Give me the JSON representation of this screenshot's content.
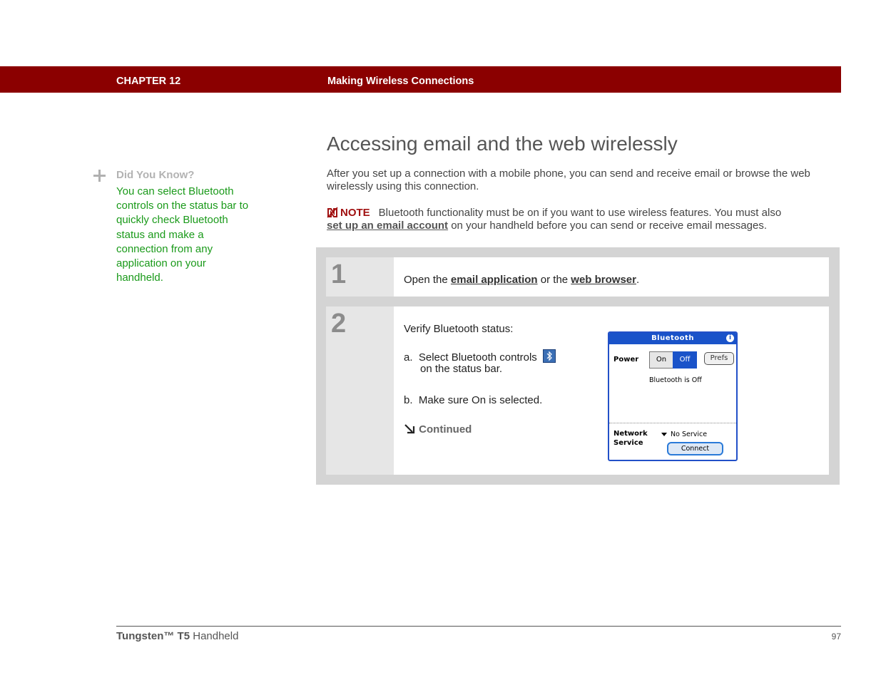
{
  "header": {
    "chapter_label": "CHAPTER 12",
    "chapter_title": "Making Wireless Connections",
    "bar_color": "#8b0000"
  },
  "sidebar": {
    "icon": "plus-icon",
    "heading": "Did You Know?",
    "text": "You can select Bluetooth controls on the status bar to quickly check Bluetooth status and make a connection from any application on your handheld.",
    "text_color": "#1a9a1a"
  },
  "main": {
    "title": "Accessing email and the web wirelessly",
    "intro": "After you set up a connection with a mobile phone, you can send and receive email or browse the web wirelessly using this connection.",
    "note": {
      "icon": "note-icon",
      "label": "NOTE",
      "text_before": "Bluetooth functionality must be on if you want to use wireless features. You must also",
      "link": "set up an email account",
      "text_after": "on your handheld before you can send or receive email messages."
    }
  },
  "steps": [
    {
      "number": "1",
      "text_before": "Open the",
      "link1": "email application",
      "text_middle": "or the",
      "link2": "web browser",
      "text_after": "."
    },
    {
      "number": "2",
      "intro": "Verify Bluetooth status:",
      "sub_a_prefix": "a.",
      "sub_a_text1": "Select Bluetooth controls",
      "sub_a_icon": "bluetooth-icon",
      "sub_a_text2": "on the status bar.",
      "sub_b_prefix": "b.",
      "sub_b_text": "Make sure On is selected.",
      "continued_icon": "arrow-down-right-icon",
      "continued": "Continued"
    }
  ],
  "device": {
    "title": "Bluetooth",
    "info_icon": "info-icon",
    "power_label": "Power",
    "on_label": "On",
    "off_label": "Off",
    "selected": "Off",
    "prefs_label": "Prefs",
    "status_text": "Bluetooth is Off",
    "network_label_1": "Network",
    "network_label_2": "Service",
    "service_value": "No Service",
    "connect_label": "Connect",
    "accent_color": "#1a53c9"
  },
  "footer": {
    "product_bold": "Tungsten™ T5",
    "product_rest": "Handheld",
    "page_number": "97"
  }
}
